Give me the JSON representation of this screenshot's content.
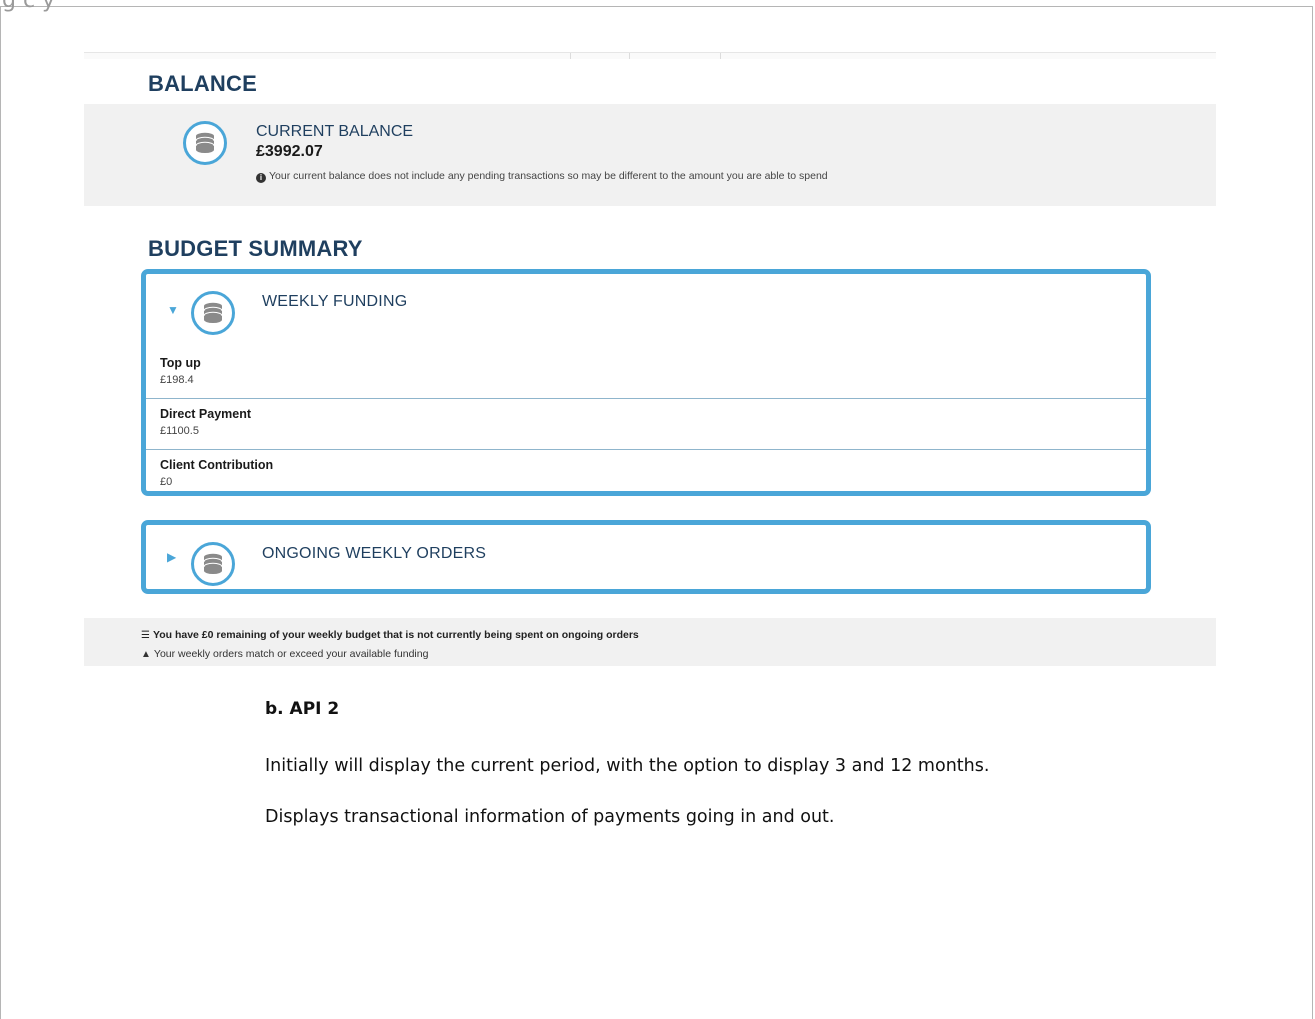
{
  "page_header_fragment": "g   c   y",
  "balance": {
    "heading": "BALANCE",
    "current_label": "CURRENT BALANCE",
    "current_value": "£3992.07",
    "note": "Your current balance does not include any pending transactions so may be different to the amount you are able to spend",
    "icon": "coins-icon"
  },
  "budget_summary": {
    "heading": "BUDGET SUMMARY",
    "weekly_funding": {
      "title": "WEEKLY FUNDING",
      "expanded": true,
      "rows": [
        {
          "label": "Top up",
          "value": "£198.4"
        },
        {
          "label": "Direct Payment",
          "value": "£1100.5"
        },
        {
          "label": "Client Contribution",
          "value": "£0"
        }
      ]
    },
    "ongoing_orders": {
      "title": "ONGOING WEEKLY ORDERS",
      "expanded": false
    }
  },
  "footer": {
    "remaining_message": "You have £0 remaining of your weekly budget that is not currently being spent on ongoing orders",
    "warning_message": "Your weekly orders match or exceed your available funding"
  },
  "document": {
    "heading": "b. API 2",
    "paragraph_1": "Initially will display the current period, with the option to display 3 and 12 months.",
    "paragraph_2": "Displays transactional information of payments going in and out."
  },
  "colors": {
    "accent": "#4aa6d8",
    "heading_navy": "#1f3f5f",
    "panel_grey": "#f1f1f1"
  }
}
